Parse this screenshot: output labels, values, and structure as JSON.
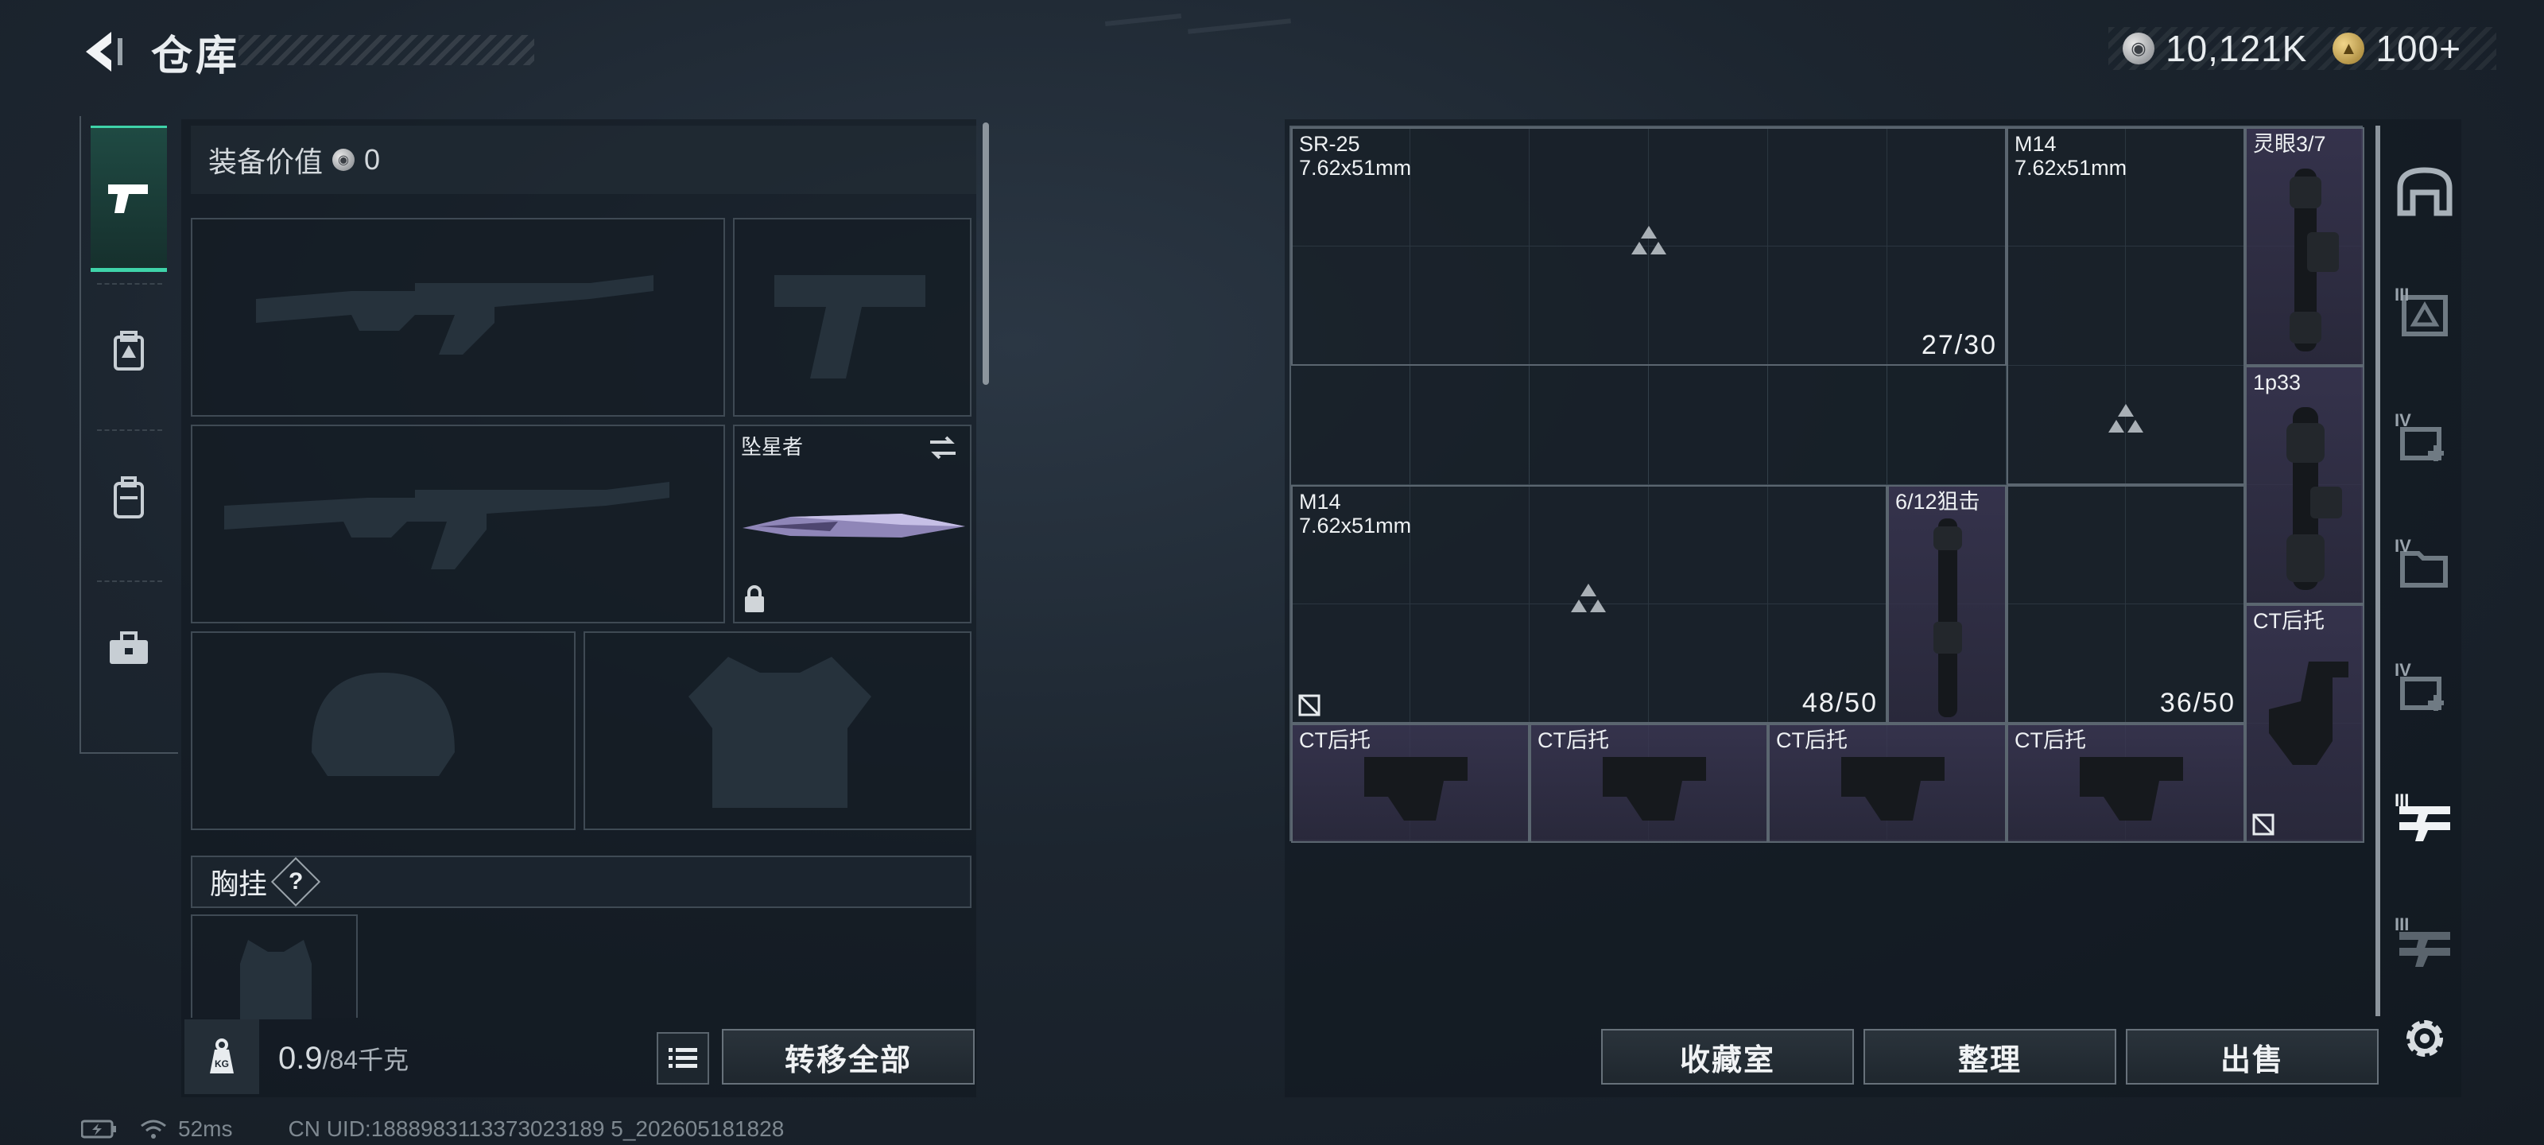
{
  "header": {
    "title": "仓库",
    "currencies": [
      {
        "icon": "silver-coin-icon",
        "value": "10,121K"
      },
      {
        "icon": "gold-coin-icon",
        "value": "100+"
      }
    ]
  },
  "left_rail": {
    "items": [
      {
        "icon": "pistol-icon",
        "active": true
      },
      {
        "icon": "armor-icon",
        "active": false
      },
      {
        "icon": "backpack-icon",
        "active": false
      },
      {
        "icon": "toolbox-icon",
        "active": false
      }
    ]
  },
  "loadout": {
    "equip_value_label": "装备价值",
    "equip_value": "0",
    "melee_slot_name": "坠星者",
    "chest_rig_label": "胸挂",
    "chest_rig_help": "?"
  },
  "bottom_left": {
    "weight_icon_label": "KG",
    "weight_current": "0.9",
    "weight_max": "/84千克",
    "transfer_all_label": "转移全部"
  },
  "status": {
    "ping": "52ms",
    "uid": "CN UID:1888983113373023189 5_202605181828"
  },
  "storage_items": [
    {
      "name": "SR-25\n7.62x51mm",
      "count": "27/30"
    },
    {
      "name": "M14\n7.62x51mm",
      "count": ""
    },
    {
      "name": "灵眼3/7",
      "count": ""
    },
    {
      "name": "1p33",
      "count": ""
    },
    {
      "name": "M14\n7.62x51mm",
      "count": "48/50"
    },
    {
      "name": "6/12狙击",
      "count": ""
    },
    {
      "name": "",
      "count": "36/50"
    },
    {
      "name": "CT后托",
      "count": ""
    },
    {
      "name": "CT后托",
      "count": ""
    },
    {
      "name": "CT后托",
      "count": ""
    },
    {
      "name": "CT后托",
      "count": ""
    },
    {
      "name": "CT后托",
      "count": ""
    }
  ],
  "actions": {
    "collection_label": "收藏室",
    "sort_label": "整理",
    "sell_label": "出售"
  },
  "right_rail": {
    "tiers": [
      "III",
      "IV",
      "IV",
      "IV",
      "III",
      "III"
    ],
    "icons": [
      "home-icon",
      "tier-box-icon",
      "medkit-icon",
      "folder-icon",
      "medkit-icon",
      "rifle-stack-icon",
      "rifle-stack-icon",
      "gear-icon"
    ]
  },
  "colors": {
    "accent": "#3fd3a9",
    "purple_item_bg": "#3a3652"
  }
}
